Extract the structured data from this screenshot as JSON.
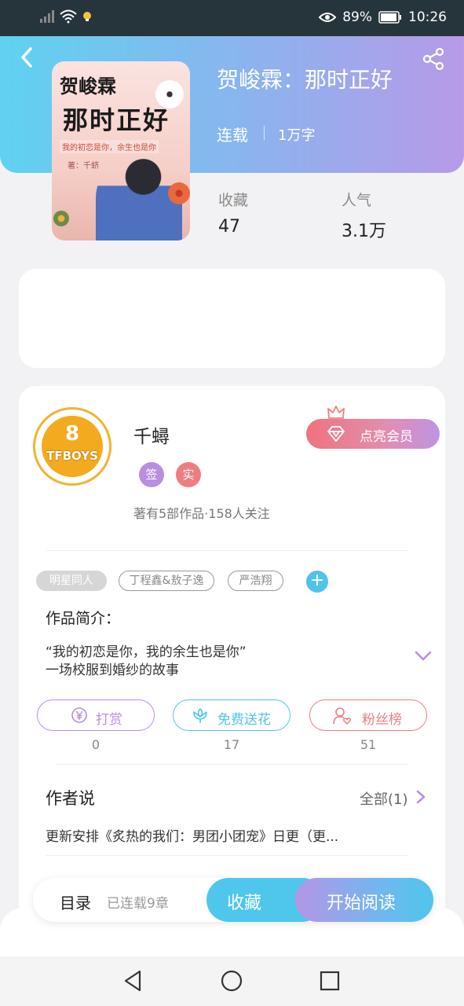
{
  "status_bar": {
    "battery": "89%",
    "time": "10:26"
  },
  "book": {
    "title": "贺峻霖：那时正好",
    "status": "连载",
    "word_count": "1万字",
    "cover": {
      "line1": "贺峻霖",
      "line2": "那时正好",
      "subtitle": "我的初恋是你，余生也是你",
      "author": "著：千蛴"
    },
    "stats": [
      {
        "label": "收藏",
        "value": "47"
      },
      {
        "label": "人气",
        "value": "3.1万"
      }
    ]
  },
  "author": {
    "name": "千蟳",
    "avatar_text": "TFBOYS",
    "avatar_num": "8",
    "badges": [
      {
        "text": "签",
        "color": "#b98ee2"
      },
      {
        "text": "实",
        "color": "#ef7d80"
      }
    ],
    "meta": "著有5部作品·158人关注",
    "vip_button": "点亮会员"
  },
  "tags": [
    "明星同人",
    "丁程鑫&敖子逸",
    "严浩翔"
  ],
  "intro": {
    "title": "作品简介：",
    "lines": [
      "“我的初恋是你，我的余生也是你”",
      "一场校服到婚纱的故事"
    ]
  },
  "actions": [
    {
      "label": "打赏",
      "count": "0",
      "color": "#b98ee2"
    },
    {
      "label": "免费送花",
      "count": "17",
      "color": "#4fc6ec"
    },
    {
      "label": "粉丝榜",
      "count": "51",
      "color": "#ef7d80"
    }
  ],
  "author_says": {
    "title": "作者说",
    "all_label": "全部(1)",
    "text": "更新安排《炙热的我们：男团小团宠》日更（更..."
  },
  "bottom_bar": {
    "toc_label": "目录",
    "toc_count": "已连载9章",
    "favorite_label": "收藏",
    "read_label": "开始阅读"
  },
  "colors": {
    "accent_blue": "#4fc6ec",
    "accent_purple": "#b98ee2",
    "accent_red": "#ef7d80"
  }
}
